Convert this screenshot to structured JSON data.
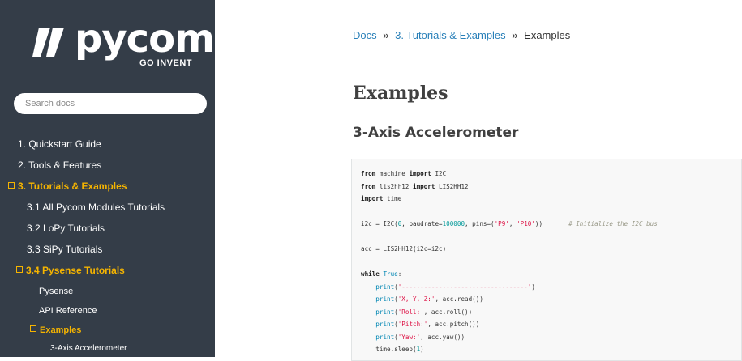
{
  "brand": {
    "name": "pycom",
    "tagline": "GO INVENT"
  },
  "search": {
    "placeholder": "Search docs"
  },
  "sidebar": {
    "items": [
      {
        "label": "1. Quickstart Guide",
        "collapsible": false,
        "active": false
      },
      {
        "label": "2. Tools & Features",
        "collapsible": false,
        "active": false
      },
      {
        "label": "3. Tutorials & Examples",
        "collapsible": true,
        "active": true
      },
      {
        "label": "3.1 All Pycom Modules Tutorials",
        "collapsible": false,
        "active": false
      },
      {
        "label": "3.2 LoPy Tutorials",
        "collapsible": false,
        "active": false
      },
      {
        "label": "3.3 SiPy Tutorials",
        "collapsible": false,
        "active": false
      },
      {
        "label": "3.4 Pysense Tutorials",
        "collapsible": true,
        "active": true
      },
      {
        "label": "Pysense",
        "collapsible": false,
        "active": false
      },
      {
        "label": "API Reference",
        "collapsible": false,
        "active": false
      },
      {
        "label": "Examples",
        "collapsible": true,
        "active": true
      },
      {
        "label": "3-Axis Accelerometer",
        "collapsible": false,
        "active": false
      }
    ]
  },
  "breadcrumb": {
    "docs": "Docs",
    "sep": "»",
    "section": "3. Tutorials & Examples",
    "current": "Examples"
  },
  "page": {
    "title": "Examples",
    "subtitle": "3-Axis Accelerometer"
  },
  "code": {
    "lines": [
      [
        [
          "kw",
          "from"
        ],
        [
          "t",
          " machine "
        ],
        [
          "kw",
          "import"
        ],
        [
          "t",
          " I2C"
        ]
      ],
      [
        [
          "kw",
          "from"
        ],
        [
          "t",
          " lis2hh12 "
        ],
        [
          "kw",
          "import"
        ],
        [
          "t",
          " LIS2HH12"
        ]
      ],
      [
        [
          "kw",
          "import"
        ],
        [
          "t",
          " time"
        ]
      ],
      [],
      [
        [
          "t",
          "i2c = I2C("
        ],
        [
          "num",
          "0"
        ],
        [
          "t",
          ", baudrate="
        ],
        [
          "num",
          "100000"
        ],
        [
          "t",
          ", pins=("
        ],
        [
          "str",
          "'P9'"
        ],
        [
          "t",
          ", "
        ],
        [
          "str",
          "'P10'"
        ],
        [
          "t",
          "))       "
        ],
        [
          "cm",
          "# Initialize the I2C bus"
        ]
      ],
      [],
      [
        [
          "t",
          "acc = LIS2HH12(i2c=i2c)"
        ]
      ],
      [],
      [
        [
          "kw",
          "while"
        ],
        [
          "t",
          " "
        ],
        [
          "fn",
          "True"
        ],
        [
          "t",
          ":"
        ]
      ],
      [
        [
          "t",
          "    "
        ],
        [
          "fn",
          "print"
        ],
        [
          "t",
          "("
        ],
        [
          "str",
          "'----------------------------------'"
        ],
        [
          "t",
          ")"
        ]
      ],
      [
        [
          "t",
          "    "
        ],
        [
          "fn",
          "print"
        ],
        [
          "t",
          "("
        ],
        [
          "str",
          "'X, Y, Z:'"
        ],
        [
          "t",
          ", acc.read())"
        ]
      ],
      [
        [
          "t",
          "    "
        ],
        [
          "fn",
          "print"
        ],
        [
          "t",
          "("
        ],
        [
          "str",
          "'Roll:'"
        ],
        [
          "t",
          ", acc.roll())"
        ]
      ],
      [
        [
          "t",
          "    "
        ],
        [
          "fn",
          "print"
        ],
        [
          "t",
          "("
        ],
        [
          "str",
          "'Pitch:'"
        ],
        [
          "t",
          ", acc.pitch())"
        ]
      ],
      [
        [
          "t",
          "    "
        ],
        [
          "fn",
          "print"
        ],
        [
          "t",
          "("
        ],
        [
          "str",
          "'Yaw:'"
        ],
        [
          "t",
          ", acc.yaw())"
        ]
      ],
      [
        [
          "t",
          "    time.sleep("
        ],
        [
          "num",
          "1"
        ],
        [
          "t",
          ")"
        ]
      ]
    ]
  },
  "colors": {
    "sidebar_bg": "#343d48",
    "active": "#f5b400",
    "link": "#2980b9"
  }
}
